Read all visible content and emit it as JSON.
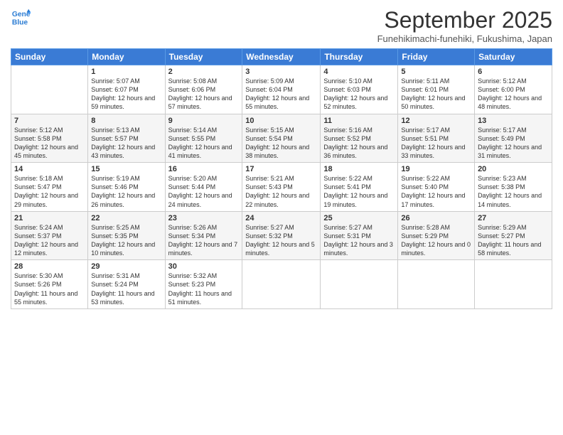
{
  "header": {
    "logo_line1": "General",
    "logo_line2": "Blue",
    "month_title": "September 2025",
    "location": "Funehikimachi-funehiki, Fukushima, Japan"
  },
  "weekdays": [
    "Sunday",
    "Monday",
    "Tuesday",
    "Wednesday",
    "Thursday",
    "Friday",
    "Saturday"
  ],
  "weeks": [
    {
      "cells": [
        {
          "day": "",
          "empty": true
        },
        {
          "day": "1",
          "sunrise": "5:07 AM",
          "sunset": "6:07 PM",
          "daylight": "12 hours and 59 minutes."
        },
        {
          "day": "2",
          "sunrise": "5:08 AM",
          "sunset": "6:06 PM",
          "daylight": "12 hours and 57 minutes."
        },
        {
          "day": "3",
          "sunrise": "5:09 AM",
          "sunset": "6:04 PM",
          "daylight": "12 hours and 55 minutes."
        },
        {
          "day": "4",
          "sunrise": "5:10 AM",
          "sunset": "6:03 PM",
          "daylight": "12 hours and 52 minutes."
        },
        {
          "day": "5",
          "sunrise": "5:11 AM",
          "sunset": "6:01 PM",
          "daylight": "12 hours and 50 minutes."
        },
        {
          "day": "6",
          "sunrise": "5:12 AM",
          "sunset": "6:00 PM",
          "daylight": "12 hours and 48 minutes."
        }
      ]
    },
    {
      "cells": [
        {
          "day": "7",
          "sunrise": "5:12 AM",
          "sunset": "5:58 PM",
          "daylight": "12 hours and 45 minutes."
        },
        {
          "day": "8",
          "sunrise": "5:13 AM",
          "sunset": "5:57 PM",
          "daylight": "12 hours and 43 minutes."
        },
        {
          "day": "9",
          "sunrise": "5:14 AM",
          "sunset": "5:55 PM",
          "daylight": "12 hours and 41 minutes."
        },
        {
          "day": "10",
          "sunrise": "5:15 AM",
          "sunset": "5:54 PM",
          "daylight": "12 hours and 38 minutes."
        },
        {
          "day": "11",
          "sunrise": "5:16 AM",
          "sunset": "5:52 PM",
          "daylight": "12 hours and 36 minutes."
        },
        {
          "day": "12",
          "sunrise": "5:17 AM",
          "sunset": "5:51 PM",
          "daylight": "12 hours and 33 minutes."
        },
        {
          "day": "13",
          "sunrise": "5:17 AM",
          "sunset": "5:49 PM",
          "daylight": "12 hours and 31 minutes."
        }
      ]
    },
    {
      "cells": [
        {
          "day": "14",
          "sunrise": "5:18 AM",
          "sunset": "5:47 PM",
          "daylight": "12 hours and 29 minutes."
        },
        {
          "day": "15",
          "sunrise": "5:19 AM",
          "sunset": "5:46 PM",
          "daylight": "12 hours and 26 minutes."
        },
        {
          "day": "16",
          "sunrise": "5:20 AM",
          "sunset": "5:44 PM",
          "daylight": "12 hours and 24 minutes."
        },
        {
          "day": "17",
          "sunrise": "5:21 AM",
          "sunset": "5:43 PM",
          "daylight": "12 hours and 22 minutes."
        },
        {
          "day": "18",
          "sunrise": "5:22 AM",
          "sunset": "5:41 PM",
          "daylight": "12 hours and 19 minutes."
        },
        {
          "day": "19",
          "sunrise": "5:22 AM",
          "sunset": "5:40 PM",
          "daylight": "12 hours and 17 minutes."
        },
        {
          "day": "20",
          "sunrise": "5:23 AM",
          "sunset": "5:38 PM",
          "daylight": "12 hours and 14 minutes."
        }
      ]
    },
    {
      "cells": [
        {
          "day": "21",
          "sunrise": "5:24 AM",
          "sunset": "5:37 PM",
          "daylight": "12 hours and 12 minutes."
        },
        {
          "day": "22",
          "sunrise": "5:25 AM",
          "sunset": "5:35 PM",
          "daylight": "12 hours and 10 minutes."
        },
        {
          "day": "23",
          "sunrise": "5:26 AM",
          "sunset": "5:34 PM",
          "daylight": "12 hours and 7 minutes."
        },
        {
          "day": "24",
          "sunrise": "5:27 AM",
          "sunset": "5:32 PM",
          "daylight": "12 hours and 5 minutes."
        },
        {
          "day": "25",
          "sunrise": "5:27 AM",
          "sunset": "5:31 PM",
          "daylight": "12 hours and 3 minutes."
        },
        {
          "day": "26",
          "sunrise": "5:28 AM",
          "sunset": "5:29 PM",
          "daylight": "12 hours and 0 minutes."
        },
        {
          "day": "27",
          "sunrise": "5:29 AM",
          "sunset": "5:27 PM",
          "daylight": "11 hours and 58 minutes."
        }
      ]
    },
    {
      "cells": [
        {
          "day": "28",
          "sunrise": "5:30 AM",
          "sunset": "5:26 PM",
          "daylight": "11 hours and 55 minutes."
        },
        {
          "day": "29",
          "sunrise": "5:31 AM",
          "sunset": "5:24 PM",
          "daylight": "11 hours and 53 minutes."
        },
        {
          "day": "30",
          "sunrise": "5:32 AM",
          "sunset": "5:23 PM",
          "daylight": "11 hours and 51 minutes."
        },
        {
          "day": "",
          "empty": true
        },
        {
          "day": "",
          "empty": true
        },
        {
          "day": "",
          "empty": true
        },
        {
          "day": "",
          "empty": true
        }
      ]
    }
  ],
  "labels": {
    "sunrise_prefix": "Sunrise:",
    "sunset_prefix": "Sunset:",
    "daylight_prefix": "Daylight:"
  }
}
